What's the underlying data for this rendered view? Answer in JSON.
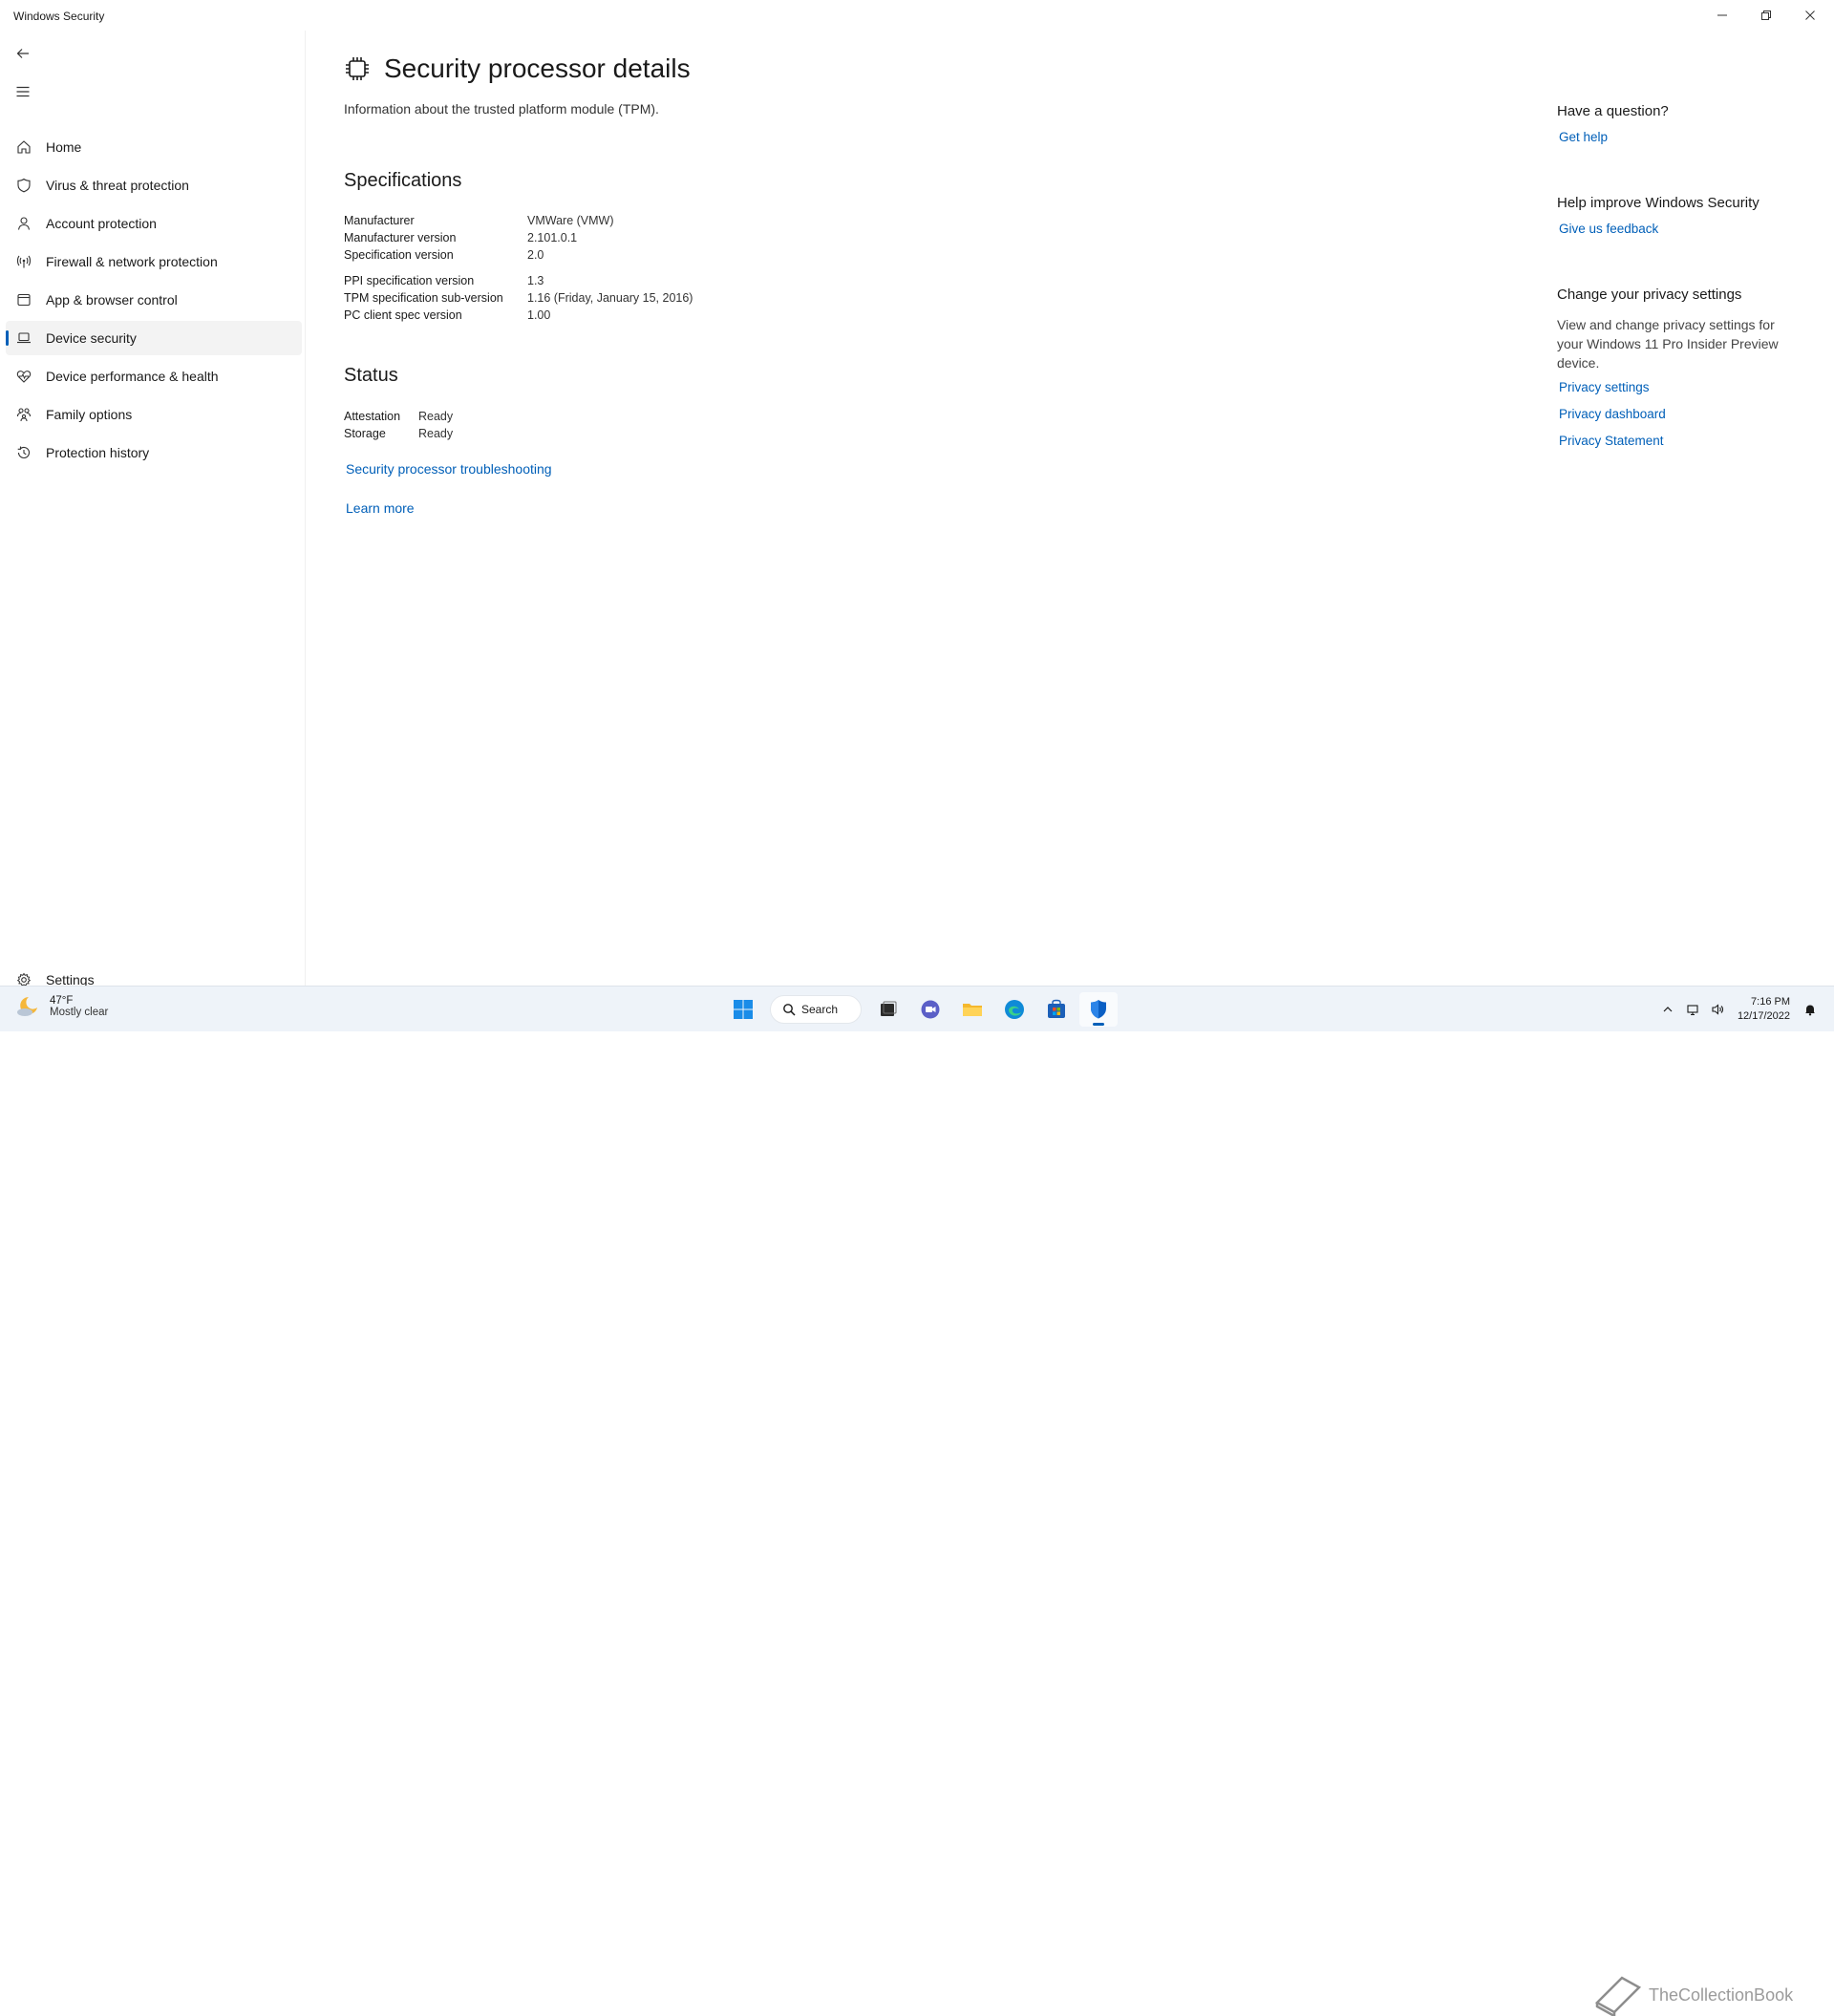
{
  "window": {
    "title": "Windows Security",
    "controls": [
      "minimize",
      "restore",
      "close"
    ]
  },
  "sidebar": {
    "items": [
      {
        "label": "Home",
        "icon": "home-icon"
      },
      {
        "label": "Virus & threat protection",
        "icon": "shield-icon"
      },
      {
        "label": "Account protection",
        "icon": "person-icon"
      },
      {
        "label": "Firewall & network protection",
        "icon": "antenna-icon"
      },
      {
        "label": "App & browser control",
        "icon": "app-window-icon"
      },
      {
        "label": "Device security",
        "icon": "laptop-icon",
        "active": true
      },
      {
        "label": "Device performance & health",
        "icon": "heart-pulse-icon"
      },
      {
        "label": "Family options",
        "icon": "family-icon"
      },
      {
        "label": "Protection history",
        "icon": "history-icon"
      }
    ],
    "settings_label": "Settings"
  },
  "main": {
    "title": "Security processor details",
    "description": "Information about the trusted platform module (TPM).",
    "specifications": {
      "heading": "Specifications",
      "group1": [
        {
          "key": "Manufacturer",
          "value": "VMWare (VMW)"
        },
        {
          "key": "Manufacturer version",
          "value": "2.101.0.1"
        },
        {
          "key": "Specification version",
          "value": "2.0"
        }
      ],
      "group2": [
        {
          "key": "PPI specification version",
          "value": "1.3"
        },
        {
          "key": "TPM specification sub-version",
          "value": "1.16 (Friday, January 15, 2016)"
        },
        {
          "key": "PC client spec version",
          "value": "1.00"
        }
      ]
    },
    "status": {
      "heading": "Status",
      "rows": [
        {
          "key": "Attestation",
          "value": "Ready"
        },
        {
          "key": "Storage",
          "value": "Ready"
        }
      ]
    },
    "troubleshooting_link": "Security processor troubleshooting",
    "learn_more_link": "Learn more"
  },
  "right_panel": {
    "question_heading": "Have a question?",
    "get_help": "Get help",
    "improve_heading": "Help improve Windows Security",
    "feedback": "Give us feedback",
    "privacy_heading": "Change your privacy settings",
    "privacy_text": "View and change privacy settings for your Windows 11 Pro Insider Preview device.",
    "privacy_settings": "Privacy settings",
    "privacy_dashboard": "Privacy dashboard",
    "privacy_statement": "Privacy Statement"
  },
  "taskbar": {
    "weather_temp": "47°F",
    "weather_condition": "Mostly clear",
    "search_label": "Search",
    "time": "7:16 PM",
    "date": "12/17/2022",
    "watermark": "TheCollectionBook",
    "colors": {
      "accent": "#005fb8",
      "background": "#eef3f9"
    }
  }
}
